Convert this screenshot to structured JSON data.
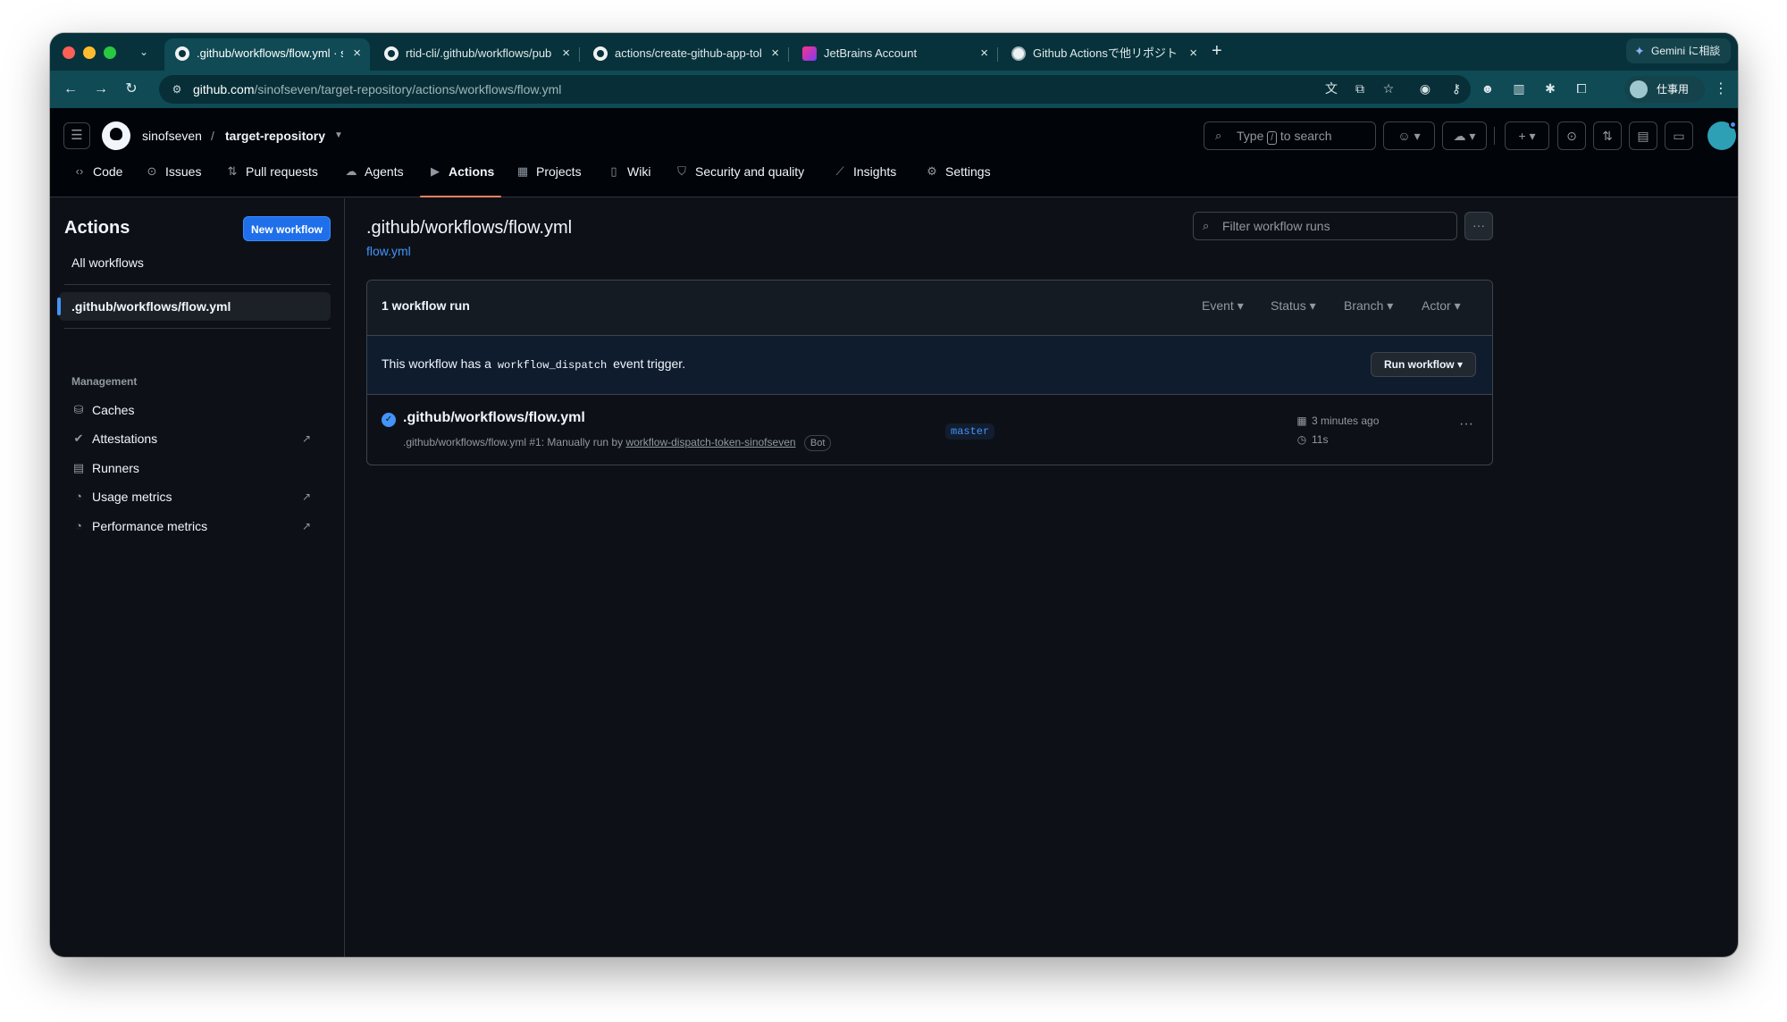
{
  "browser": {
    "tabs": [
      {
        "label": ".github/workflows/flow.yml · sinofseven/target-repository",
        "icon": "github-icon",
        "active": true
      },
      {
        "label": "rtid-cli/.github/workflows/publish.yml",
        "icon": "github-icon",
        "active": false
      },
      {
        "label": "actions/create-github-app-token",
        "icon": "github-icon",
        "active": false
      },
      {
        "label": "JetBrains Account",
        "icon": "jetbrains-icon",
        "active": false
      },
      {
        "label": "Github Actionsで他リポジトリのワークフローを実行",
        "icon": "globe-icon",
        "active": false
      }
    ],
    "gemini_label": "Gemini に相談",
    "url_host": "github.com",
    "url_path": "/sinofseven/target-repository/actions/workflows/flow.yml",
    "profile_label": "仕事用"
  },
  "header": {
    "owner": "sinofseven",
    "separator": "/",
    "repo": "target-repository",
    "search_prefix": "Type",
    "search_key": "/",
    "search_suffix": "to search"
  },
  "repo_nav": [
    {
      "label": "Code",
      "icon": "code-icon"
    },
    {
      "label": "Issues",
      "icon": "issue-icon"
    },
    {
      "label": "Pull requests",
      "icon": "pull-request-icon"
    },
    {
      "label": "Agents",
      "icon": "agents-icon"
    },
    {
      "label": "Actions",
      "icon": "play-icon",
      "active": true
    },
    {
      "label": "Projects",
      "icon": "table-icon"
    },
    {
      "label": "Wiki",
      "icon": "book-icon"
    },
    {
      "label": "Security and quality",
      "icon": "shield-icon"
    },
    {
      "label": "Insights",
      "icon": "graph-icon"
    },
    {
      "label": "Settings",
      "icon": "gear-icon"
    }
  ],
  "sidebar": {
    "title": "Actions",
    "new_workflow": "New workflow",
    "all_workflows": "All workflows",
    "selected_workflow": ".github/workflows/flow.yml",
    "management_heading": "Management",
    "items": [
      {
        "label": "Caches",
        "icon": "database-icon",
        "external": false
      },
      {
        "label": "Attestations",
        "icon": "verified-icon",
        "external": true
      },
      {
        "label": "Runners",
        "icon": "server-icon",
        "external": false
      },
      {
        "label": "Usage metrics",
        "icon": "meter-icon",
        "external": true
      },
      {
        "label": "Performance metrics",
        "icon": "meter-icon",
        "external": true
      }
    ]
  },
  "main": {
    "title": ".github/workflows/flow.yml",
    "file_link": "flow.yml",
    "filter_placeholder": "Filter workflow runs",
    "run_count": "1 workflow run",
    "filters": [
      "Event",
      "Status",
      "Branch",
      "Actor"
    ],
    "banner_prefix": "This workflow has a",
    "banner_code": "workflow_dispatch",
    "banner_suffix": "event trigger.",
    "run_workflow": "Run workflow",
    "runs": [
      {
        "title": ".github/workflows/flow.yml",
        "meta_prefix": ".github/workflows/flow.yml #1: Manually run by",
        "actor": "workflow-dispatch-token-sinofseven",
        "actor_badge": "Bot",
        "branch": "master",
        "time": "3 minutes ago",
        "duration": "11s",
        "status": "success"
      }
    ]
  },
  "colors": {
    "accent": "#1f6feb",
    "link": "#4493f8",
    "active_tab_underline": "#f78166",
    "background": "#0d1117",
    "header_background": "#010409"
  }
}
